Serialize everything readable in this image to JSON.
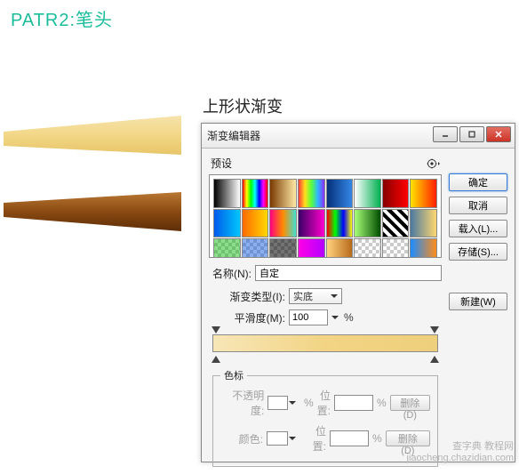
{
  "page": {
    "title": "PATR2:笔头",
    "caption": "上形状渐变"
  },
  "dialog": {
    "title": "渐变编辑器"
  },
  "labels": {
    "presets": "预设",
    "name": "名称(N):",
    "gradient_type": "渐变类型(I):",
    "smoothness": "平滑度(M):",
    "percent": "%",
    "color_stops": "色标",
    "opacity": "不透明度:",
    "location": "位置:",
    "color": "颜色:"
  },
  "values": {
    "name": "自定",
    "gradient_type": "实底",
    "smoothness": "100"
  },
  "buttons": {
    "ok": "确定",
    "cancel": "取消",
    "load": "载入(L)...",
    "save": "存储(S)...",
    "new": "新建(W)",
    "delete1": "删除(D)",
    "delete2": "删除(D)"
  },
  "icons": {
    "minimize": "minimize-icon",
    "maximize": "maximize-icon",
    "close": "close-icon",
    "gear": "gear-icon"
  },
  "watermark": {
    "line1": "查字典 教程网",
    "line2": "jiaocheng.chazidian.com"
  },
  "swatches": [
    "linear-gradient(90deg,#000,#fff)",
    "linear-gradient(90deg,#ff0000,#ffff00,#00ff00,#00ffff,#0000ff,#ff00ff,#ff0000)",
    "linear-gradient(90deg,#7a3a00,#ffe9a6)",
    "linear-gradient(90deg,#ff3d3d,#ffe11a,#59ff3d,#2db6ff,#8a2dff)",
    "linear-gradient(90deg,#05307a,#3487e6)",
    "linear-gradient(90deg,#fff,#00b050)",
    "linear-gradient(90deg,#870000,#ff0000)",
    "linear-gradient(90deg,#ffe400,#ff1e00)",
    "linear-gradient(90deg,#005bea,#00c6fb)",
    "linear-gradient(90deg,#ff6a00,#ffd800)",
    "linear-gradient(90deg,#ff0080,#ff8c00,#40e0d0)",
    "linear-gradient(90deg,#3b0066,#ff00cc)",
    "linear-gradient(90deg,#ff0000 0,#00ff00 33%,#0000ff 66%,#ffff00 100%)",
    "linear-gradient(90deg,#a8ff78,#004d00)",
    "repeating-linear-gradient(45deg,#000 0 4px,#fff 4px 8px)",
    "linear-gradient(90deg,#4b79a1,#ffd86f)",
    "checker-green",
    "checker-blue",
    "checker-black",
    "linear-gradient(90deg,#ff00e6,#b400ff)",
    "linear-gradient(90deg,#ffd27f,#b86b1a)",
    "checker-plain",
    "checker-plain",
    "linear-gradient(90deg,#1a8cff,#ff8c1a)"
  ]
}
